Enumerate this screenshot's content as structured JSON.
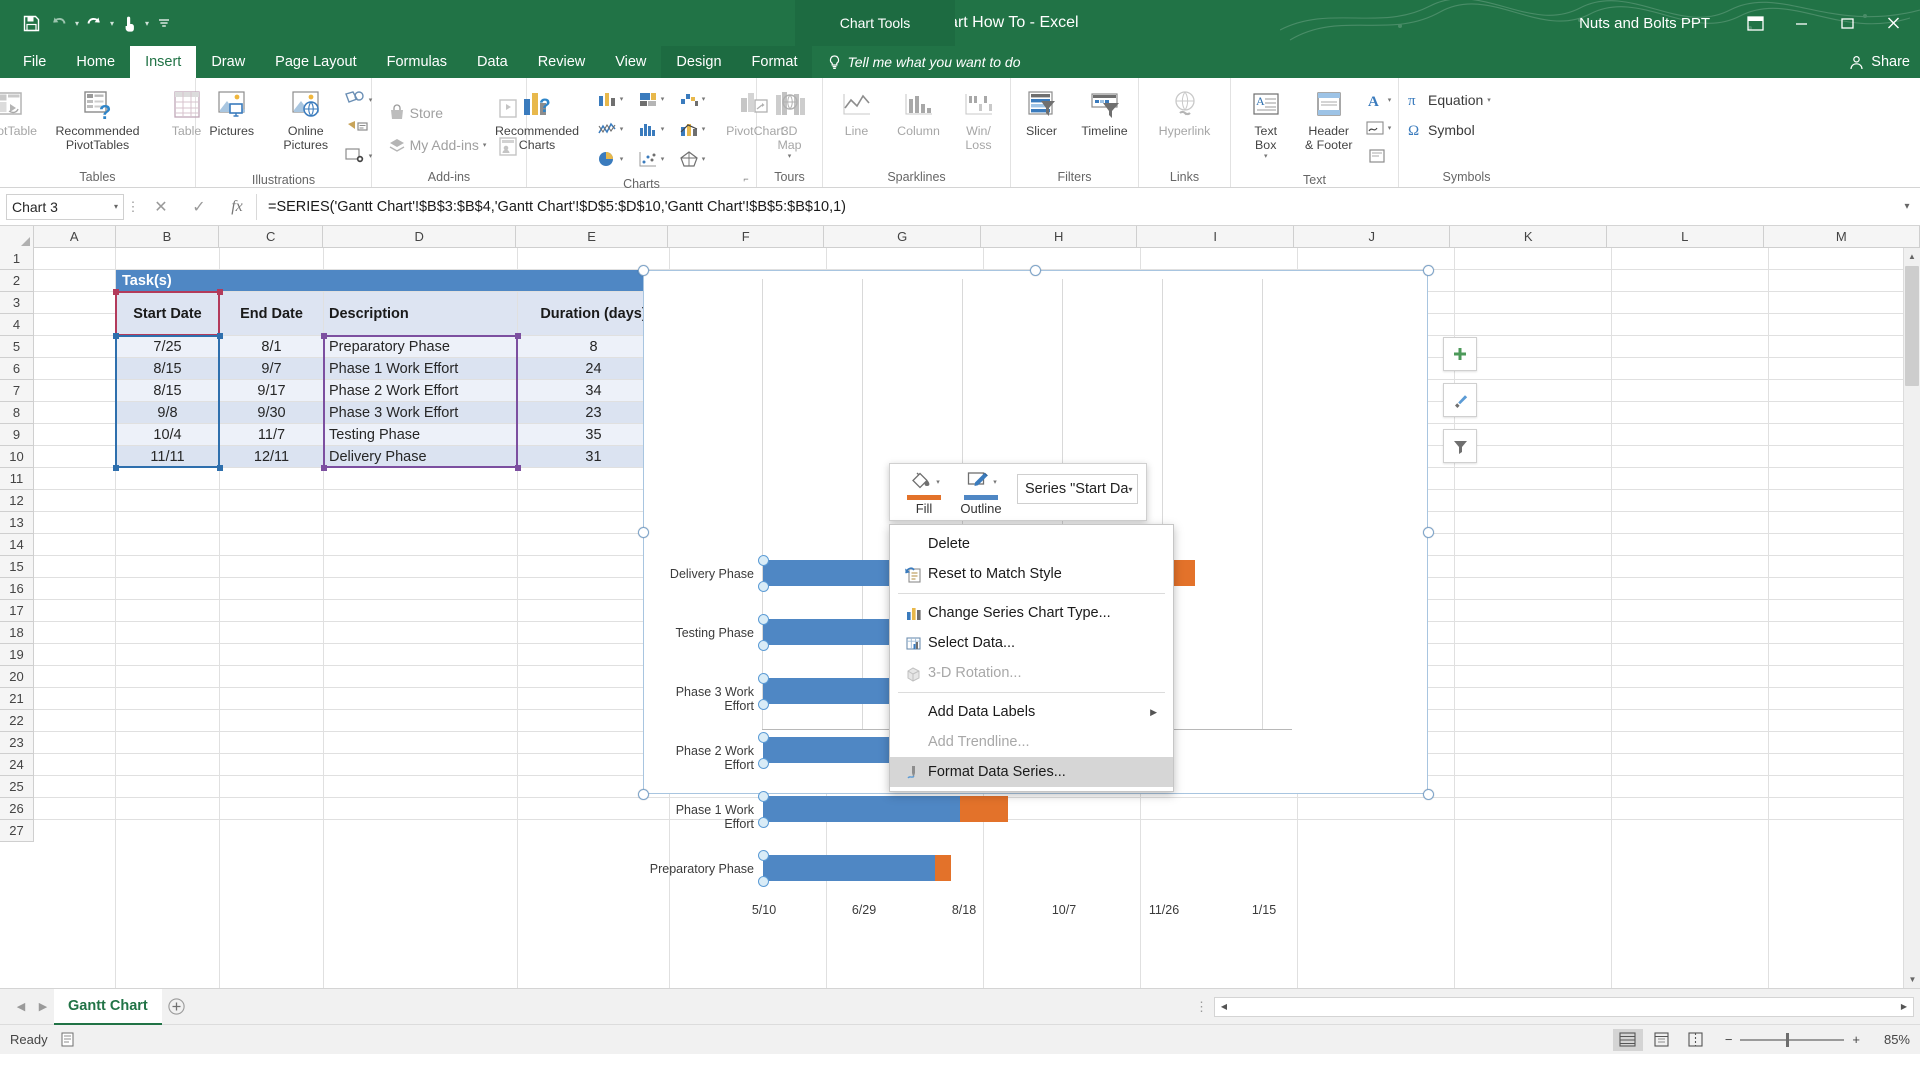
{
  "window": {
    "title": "Excel Gantt Chart How To - Excel",
    "chart_tools_label": "Chart Tools",
    "account": "Nuts and Bolts PPT",
    "ribbon_display_icon": "ribbon-display-options-icon",
    "minimize_icon": "minimize-icon",
    "restore_icon": "restore-icon",
    "close_icon": "close-icon"
  },
  "quick_access": {
    "save": "save-icon",
    "undo": "undo-icon",
    "redo": "redo-icon",
    "touch_mode": "touch-mouse-mode-icon",
    "customize": "customize-quick-access-icon"
  },
  "tabs": {
    "items": [
      {
        "label": "File",
        "active": false
      },
      {
        "label": "Home",
        "active": false
      },
      {
        "label": "Insert",
        "active": true
      },
      {
        "label": "Draw",
        "active": false
      },
      {
        "label": "Page Layout",
        "active": false
      },
      {
        "label": "Formulas",
        "active": false
      },
      {
        "label": "Data",
        "active": false
      },
      {
        "label": "Review",
        "active": false
      },
      {
        "label": "View",
        "active": false
      },
      {
        "label": "Design",
        "active": false,
        "contextual": true
      },
      {
        "label": "Format",
        "active": false,
        "contextual": true
      }
    ],
    "tell_me": "Tell me what you want to do",
    "share": "Share"
  },
  "ribbon": {
    "groups": [
      {
        "name": "Tables",
        "buttons": [
          {
            "label": "PivotTable",
            "icon": "pivottable-icon",
            "dimmed": true
          },
          {
            "label": "Recommended\nPivotTables",
            "icon": "recommended-pivottables-icon",
            "dimmed": false
          },
          {
            "label": "Table",
            "icon": "table-icon",
            "dimmed": true
          }
        ]
      },
      {
        "name": "Illustrations",
        "buttons": [
          {
            "label": "Pictures",
            "icon": "pictures-icon",
            "dimmed": false
          },
          {
            "label": "Online\nPictures",
            "icon": "online-pictures-icon",
            "dimmed": false
          }
        ],
        "small": [
          {
            "label": "",
            "icon": "shapes-icon"
          },
          {
            "label": "",
            "icon": "smartart-icon"
          },
          {
            "label": "",
            "icon": "screenshot-icon"
          }
        ]
      },
      {
        "name": "Add-ins",
        "buttons": [],
        "rows": [
          {
            "label": "Store",
            "icon": "store-icon",
            "dimmed": true
          },
          {
            "label": "My Add-ins",
            "icon": "my-addins-icon",
            "dimmed": true
          }
        ],
        "extra": [
          {
            "label": "",
            "icon": "bing-maps-icon",
            "dimmed": true
          },
          {
            "label": "",
            "icon": "people-graph-icon",
            "dimmed": true
          }
        ]
      },
      {
        "name": "Charts",
        "buttons": [
          {
            "label": "Recommended\nCharts",
            "icon": "recommended-charts-icon",
            "dimmed": false
          }
        ],
        "grid": [
          "column-chart-icon",
          "hierarchy-chart-icon",
          "waterfall-chart-icon",
          "line-chart-icon",
          "statistic-chart-icon",
          "combo-chart-icon",
          "pie-chart-icon",
          "scatter-chart-icon",
          "radar-chart-icon"
        ],
        "pivotchart": {
          "label": "PivotChart",
          "icon": "pivotchart-icon",
          "dimmed": true
        },
        "has_dialog_launcher": true
      },
      {
        "name": "Tours",
        "buttons": [
          {
            "label": "3D\nMap",
            "icon": "3d-map-icon",
            "dimmed": true
          }
        ]
      },
      {
        "name": "Sparklines",
        "buttons": [
          {
            "label": "Line",
            "icon": "sparkline-line-icon",
            "dimmed": true
          },
          {
            "label": "Column",
            "icon": "sparkline-column-icon",
            "dimmed": true
          },
          {
            "label": "Win/\nLoss",
            "icon": "sparkline-winloss-icon",
            "dimmed": true
          }
        ]
      },
      {
        "name": "Filters",
        "buttons": [
          {
            "label": "Slicer",
            "icon": "slicer-icon",
            "dimmed": false
          },
          {
            "label": "Timeline",
            "icon": "timeline-icon",
            "dimmed": false
          }
        ]
      },
      {
        "name": "Links",
        "buttons": [
          {
            "label": "Hyperlink",
            "icon": "hyperlink-icon",
            "dimmed": true
          }
        ]
      },
      {
        "name": "Text",
        "buttons": [
          {
            "label": "Text\nBox",
            "icon": "text-box-icon",
            "dimmed": false
          },
          {
            "label": "Header\n& Footer",
            "icon": "header-footer-icon",
            "dimmed": false
          }
        ],
        "small": [
          {
            "label": "",
            "icon": "wordart-icon"
          },
          {
            "label": "",
            "icon": "signature-line-icon"
          },
          {
            "label": "",
            "icon": "object-icon"
          }
        ]
      },
      {
        "name": "Symbols",
        "rows": [
          {
            "label": "Equation",
            "icon": "equation-icon",
            "dimmed": false
          },
          {
            "label": "Symbol",
            "icon": "symbol-icon",
            "dimmed": false
          }
        ]
      }
    ]
  },
  "formula_bar": {
    "name_box": "Chart 3",
    "cancel_icon": "cancel-icon",
    "enter_icon": "enter-icon",
    "function_icon": "insert-function-icon",
    "formula": "=SERIES('Gantt Chart'!$B$3:$B$4,'Gantt Chart'!$D$5:$D$10,'Gantt Chart'!$B$5:$B$10,1)",
    "expand_icon": "expand-formula-bar-icon"
  },
  "grid": {
    "columns": [
      "A",
      "B",
      "C",
      "D",
      "E",
      "F",
      "G",
      "H",
      "I",
      "J",
      "K",
      "L",
      "M"
    ],
    "rows": [
      "1",
      "2",
      "3",
      "4",
      "5",
      "6",
      "7",
      "8",
      "9",
      "10",
      "11",
      "12",
      "13",
      "14",
      "15",
      "16",
      "17",
      "18",
      "19",
      "20",
      "21",
      "22",
      "23",
      "24",
      "25",
      "26",
      "27"
    ],
    "banner": "Task(s)",
    "headers": [
      "Start Date",
      "End Date",
      "Description",
      "Duration (days)"
    ],
    "table": [
      {
        "start": "7/25",
        "end": "8/1",
        "description": "Preparatory Phase",
        "duration": "8"
      },
      {
        "start": "8/15",
        "end": "9/7",
        "description": "Phase 1 Work Effort",
        "duration": "24"
      },
      {
        "start": "8/15",
        "end": "9/17",
        "description": "Phase 2 Work Effort",
        "duration": "34"
      },
      {
        "start": "9/8",
        "end": "9/30",
        "description": "Phase 3 Work Effort",
        "duration": "23"
      },
      {
        "start": "10/4",
        "end": "11/7",
        "description": "Testing Phase",
        "duration": "35"
      },
      {
        "start": "11/11",
        "end": "12/11",
        "description": "Delivery Phase",
        "duration": "31"
      }
    ]
  },
  "chart_data": {
    "type": "bar",
    "title": "",
    "xlabel": "",
    "ylabel": "",
    "orientation": "horizontal",
    "stacked": true,
    "legend": "none",
    "grid": true,
    "categories": [
      "Preparatory Phase",
      "Phase 1 Work Effort",
      "Phase 2 Work Effort",
      "Phase 3 Work Effort",
      "Testing Phase",
      "Delivery Phase"
    ],
    "series": [
      {
        "name": "Start Date",
        "color": "#4f87c4",
        "values": [
          162,
          183,
          183,
          207,
          233,
          271
        ]
      },
      {
        "name": "Duration (days)",
        "color": "#e3722a",
        "values": [
          8,
          24,
          34,
          23,
          35,
          31
        ]
      }
    ],
    "x_tick_labels": [
      "5/10",
      "6/29",
      "8/18",
      "10/7",
      "11/26",
      "1/15"
    ],
    "selected_series": "Start Date"
  },
  "chart_side_buttons": [
    {
      "icon": "chart-elements-plus-icon",
      "name": "chart-elements"
    },
    {
      "icon": "chart-styles-brush-icon",
      "name": "chart-styles"
    },
    {
      "icon": "chart-filters-funnel-icon",
      "name": "chart-filters"
    }
  ],
  "mini_toolbar": {
    "fill": {
      "label": "Fill",
      "icon": "fill-bucket-icon",
      "color": "#e3722a"
    },
    "outline": {
      "label": "Outline",
      "icon": "outline-pencil-icon",
      "color": "#4f87c4"
    },
    "series_select": "Series \"Start Da"
  },
  "context_menu": {
    "items": [
      {
        "label": "Delete",
        "icon": "",
        "disabled": false,
        "selected": false,
        "submenu": false,
        "separator_after": false
      },
      {
        "label": "Reset to Match Style",
        "icon": "reset-style-icon",
        "disabled": false,
        "selected": false,
        "submenu": false,
        "separator_after": true
      },
      {
        "label": "Change Series Chart Type...",
        "icon": "change-chart-type-icon",
        "disabled": false,
        "selected": false,
        "submenu": false,
        "separator_after": false
      },
      {
        "label": "Select Data...",
        "icon": "select-data-icon",
        "disabled": false,
        "selected": false,
        "submenu": false,
        "separator_after": false
      },
      {
        "label": "3-D Rotation...",
        "icon": "3d-rotation-icon",
        "disabled": true,
        "selected": false,
        "submenu": false,
        "separator_after": true
      },
      {
        "label": "Add Data Labels",
        "icon": "",
        "disabled": false,
        "selected": false,
        "submenu": true,
        "separator_after": false
      },
      {
        "label": "Add Trendline...",
        "icon": "",
        "disabled": true,
        "selected": false,
        "submenu": false,
        "separator_after": false
      },
      {
        "label": "Format Data Series...",
        "icon": "format-data-series-icon",
        "disabled": false,
        "selected": true,
        "submenu": false,
        "separator_after": false
      }
    ]
  },
  "sheet_tabs": {
    "prev_icon": "previous-sheet-icon",
    "next_icon": "next-sheet-icon",
    "tabs": [
      {
        "label": "Gantt Chart",
        "active": true
      }
    ],
    "add_label": "+"
  },
  "status_bar": {
    "status": "Ready",
    "accessibility_icon": "accessibility-checker-icon",
    "views": [
      {
        "name": "normal-view",
        "icon": "normal-view-icon",
        "active": true
      },
      {
        "name": "page-layout-view",
        "icon": "page-layout-view-icon",
        "active": false
      },
      {
        "name": "page-break-view",
        "icon": "page-break-view-icon",
        "active": false
      }
    ],
    "zoom_out": "−",
    "zoom_in": "+",
    "zoom": "85%"
  }
}
